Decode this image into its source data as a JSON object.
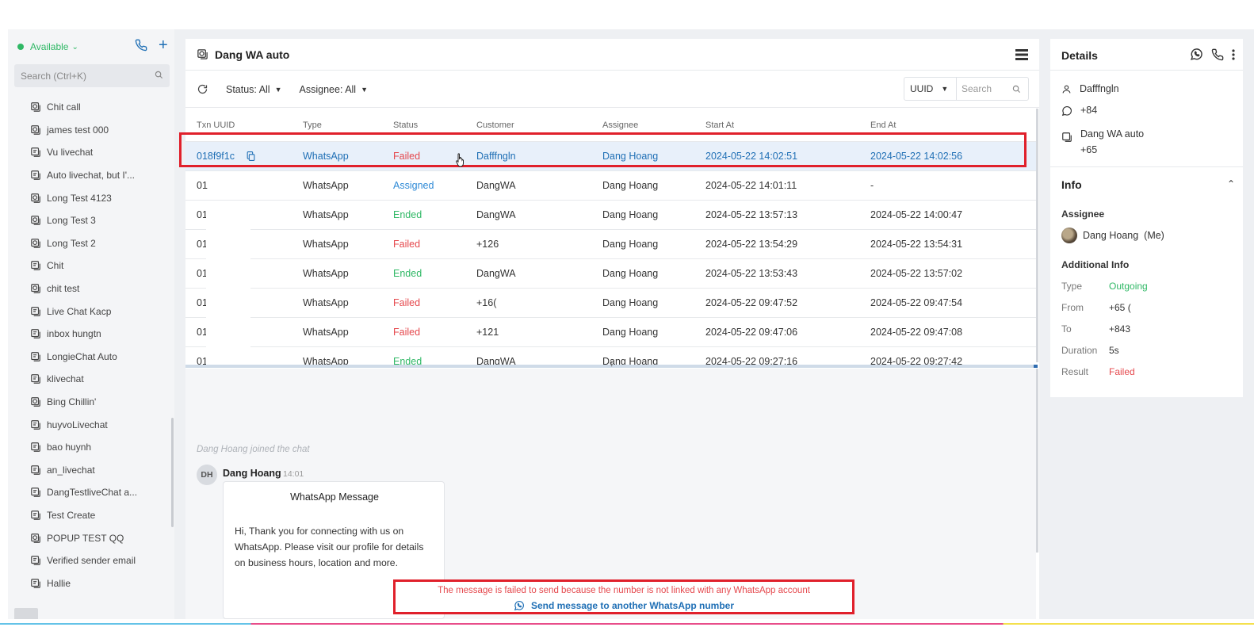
{
  "sidebar": {
    "status": "Available",
    "search_placeholder": "Search (Ctrl+K)",
    "items": [
      {
        "label": "Chit call",
        "icon": "whatsapp-icon"
      },
      {
        "label": "james test 000",
        "icon": "whatsapp-icon"
      },
      {
        "label": "Vu livechat",
        "icon": "livechat-icon"
      },
      {
        "label": "Auto livechat, but I'...",
        "icon": "livechat-icon"
      },
      {
        "label": "Long Test 4123",
        "icon": "whatsapp-icon"
      },
      {
        "label": "Long Test 3",
        "icon": "whatsapp-icon"
      },
      {
        "label": "Long Test 2",
        "icon": "whatsapp-icon"
      },
      {
        "label": "Chit",
        "icon": "livechat-icon"
      },
      {
        "label": "chit test",
        "icon": "whatsapp-icon"
      },
      {
        "label": "Live Chat Kacp",
        "icon": "livechat-icon"
      },
      {
        "label": "inbox hungtn",
        "icon": "livechat-icon"
      },
      {
        "label": "LongieChat Auto",
        "icon": "livechat-icon"
      },
      {
        "label": "klivechat",
        "icon": "livechat-icon"
      },
      {
        "label": "Bing Chillin'",
        "icon": "whatsapp-icon"
      },
      {
        "label": "huyvoLivechat",
        "icon": "livechat-icon"
      },
      {
        "label": "bao huynh",
        "icon": "livechat-icon"
      },
      {
        "label": "an_livechat",
        "icon": "livechat-icon"
      },
      {
        "label": "DangTestliveChat a...",
        "icon": "livechat-icon"
      },
      {
        "label": "Test Create",
        "icon": "livechat-icon"
      },
      {
        "label": "POPUP TEST QQ",
        "icon": "whatsapp-icon"
      },
      {
        "label": "Verified sender email",
        "icon": "livechat-icon"
      },
      {
        "label": "Hallie",
        "icon": "livechat-icon"
      }
    ]
  },
  "main": {
    "title": "Dang WA auto",
    "filters": {
      "status": "Status: All",
      "assignee": "Assignee: All"
    },
    "search_type": "UUID",
    "search_placeholder": "Search",
    "columns": [
      "Txn UUID",
      "Type",
      "Status",
      "Customer",
      "Assignee",
      "Start At",
      "End At"
    ],
    "rows": [
      {
        "uuid": "018f9f1c",
        "type": "WhatsApp",
        "status": "Failed",
        "customer": "Dafffngln",
        "assignee": "Dang Hoang",
        "start": "2024-05-22 14:02:51",
        "end": "2024-05-22 14:02:56"
      },
      {
        "uuid": "01",
        "type": "WhatsApp",
        "status": "Assigned",
        "customer": "DangWA",
        "assignee": "Dang Hoang",
        "start": "2024-05-22 14:01:11",
        "end": "-"
      },
      {
        "uuid": "01",
        "type": "WhatsApp",
        "status": "Ended",
        "customer": "DangWA",
        "assignee": "Dang Hoang",
        "start": "2024-05-22 13:57:13",
        "end": "2024-05-22 14:00:47"
      },
      {
        "uuid": "01",
        "type": "WhatsApp",
        "status": "Failed",
        "customer": "+126",
        "assignee": "Dang Hoang",
        "start": "2024-05-22 13:54:29",
        "end": "2024-05-22 13:54:31"
      },
      {
        "uuid": "01",
        "type": "WhatsApp",
        "status": "Ended",
        "customer": "DangWA",
        "assignee": "Dang Hoang",
        "start": "2024-05-22 13:53:43",
        "end": "2024-05-22 13:57:02"
      },
      {
        "uuid": "01",
        "type": "WhatsApp",
        "status": "Failed",
        "customer": "+16(",
        "assignee": "Dang Hoang",
        "start": "2024-05-22 09:47:52",
        "end": "2024-05-22 09:47:54"
      },
      {
        "uuid": "01",
        "type": "WhatsApp",
        "status": "Failed",
        "customer": "+121",
        "assignee": "Dang Hoang",
        "start": "2024-05-22 09:47:06",
        "end": "2024-05-22 09:47:08"
      },
      {
        "uuid": "01",
        "type": "WhatsApp",
        "status": "Ended",
        "customer": "DangWA",
        "assignee": "Dang Hoang",
        "start": "2024-05-22 09:27:16",
        "end": "2024-05-22 09:27:42"
      }
    ]
  },
  "chat": {
    "joined": "Dang Hoang joined the chat",
    "avatar_initials": "DH",
    "sender": "Dang Hoang",
    "time": "14:01",
    "message_title": "WhatsApp Message",
    "message_lines": [
      "Hi, Thank you for connecting with us on",
      "WhatsApp. Please visit our profile for details",
      "on business hours, location and more."
    ],
    "error_text": "The message is failed to send because the number is not linked with any WhatsApp account",
    "error_link": "Send message to another WhatsApp number"
  },
  "details": {
    "title": "Details",
    "customer_name": "Dafffngln",
    "customer_phone": "+84",
    "channel_name": "Dang WA auto",
    "channel_phone": "+65",
    "info_title": "Info",
    "assignee_label": "Assignee",
    "assignee_name": "Dang Hoang",
    "assignee_me": "(Me)",
    "additional_label": "Additional Info",
    "kv": [
      {
        "k": "Type",
        "v": "Outgoing"
      },
      {
        "k": "From",
        "v": "+65 ("
      },
      {
        "k": "To",
        "v": "+843"
      },
      {
        "k": "Duration",
        "v": "5s"
      },
      {
        "k": "Result",
        "v": "Failed"
      }
    ]
  },
  "colors": {
    "accent": "#1f6fb5",
    "failed": "#e5484d",
    "ended": "#2fb865",
    "assigned": "#2f8ad6",
    "highlight": "#e0202b"
  }
}
